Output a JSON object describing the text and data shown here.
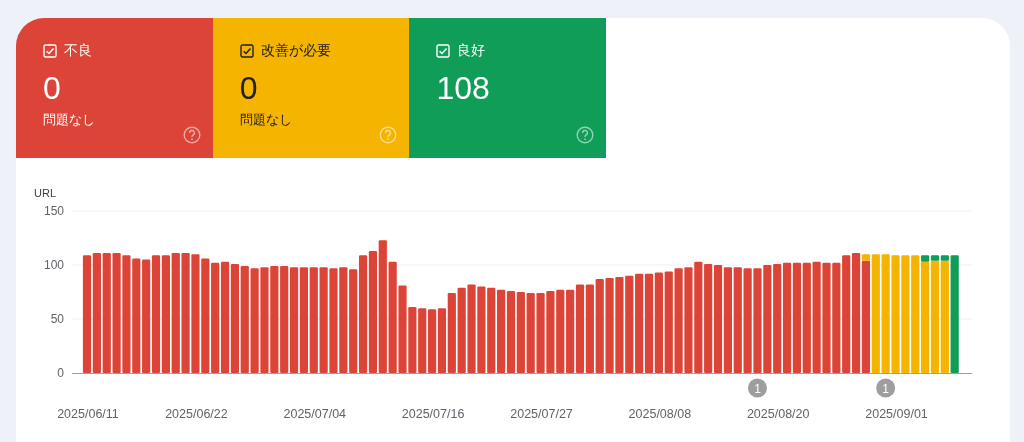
{
  "cards": [
    {
      "kind": "poor",
      "label": "不良",
      "checked": true,
      "count": "0",
      "note": "問題なし"
    },
    {
      "kind": "needs_improvement",
      "label": "改善が必要",
      "checked": true,
      "count": "0",
      "note": "問題なし"
    },
    {
      "kind": "good",
      "label": "良好",
      "checked": true,
      "count": "108"
    }
  ],
  "chart": {
    "chart_data": {
      "type": "bar",
      "stacked": true,
      "ylabel": "URL",
      "categories": [
        "2025/06/11",
        null,
        null,
        null,
        null,
        null,
        null,
        null,
        null,
        null,
        null,
        "2025/06/22",
        null,
        null,
        null,
        null,
        null,
        null,
        null,
        null,
        null,
        null,
        null,
        "2025/07/04",
        null,
        null,
        null,
        null,
        null,
        null,
        null,
        null,
        null,
        null,
        null,
        "2025/07/16",
        null,
        null,
        null,
        null,
        null,
        null,
        null,
        null,
        null,
        null,
        "2025/07/27",
        null,
        null,
        null,
        null,
        null,
        null,
        null,
        null,
        null,
        null,
        null,
        "2025/08/08",
        null,
        null,
        null,
        null,
        null,
        null,
        null,
        null,
        null,
        null,
        null,
        "2025/08/20",
        null,
        null,
        null,
        null,
        null,
        null,
        null,
        null,
        null,
        null,
        null,
        "2025/09/01",
        null,
        null,
        null,
        null,
        null,
        null
      ],
      "ylim": [
        0,
        150
      ],
      "yticks": [
        0,
        50,
        100,
        150
      ],
      "series": [
        {
          "color": "#db4437",
          "values": [
            109,
            111,
            111,
            111,
            109,
            106,
            105,
            109,
            109,
            111,
            111,
            110,
            106,
            102,
            103,
            101,
            99,
            97,
            98,
            99,
            99,
            98,
            98,
            98,
            98,
            97,
            98,
            96,
            109,
            113,
            123,
            103,
            81,
            61,
            60,
            59,
            60,
            74,
            79,
            82,
            80,
            79,
            77,
            76,
            75,
            74,
            74,
            76,
            77,
            77,
            82,
            82,
            87,
            88,
            89,
            90,
            92,
            92,
            93,
            94,
            97,
            98,
            103,
            101,
            100,
            98,
            98,
            97,
            97,
            100,
            101,
            102,
            102,
            102,
            103,
            102,
            102,
            109,
            111,
            104,
            0,
            0,
            0,
            0,
            0,
            0,
            0,
            0,
            0
          ]
        },
        {
          "color": "#f4b400",
          "values": [
            0,
            0,
            0,
            0,
            0,
            0,
            0,
            0,
            0,
            0,
            0,
            0,
            0,
            0,
            0,
            0,
            0,
            0,
            0,
            0,
            0,
            0,
            0,
            0,
            0,
            0,
            0,
            0,
            0,
            0,
            0,
            0,
            0,
            0,
            0,
            0,
            0,
            0,
            0,
            0,
            0,
            0,
            0,
            0,
            0,
            0,
            0,
            0,
            0,
            0,
            0,
            0,
            0,
            0,
            0,
            0,
            0,
            0,
            0,
            0,
            0,
            0,
            0,
            0,
            0,
            0,
            0,
            0,
            0,
            0,
            0,
            0,
            0,
            0,
            0,
            0,
            0,
            0,
            0,
            6,
            110,
            110,
            109,
            109,
            109,
            103,
            104,
            104,
            0
          ]
        },
        {
          "color": "#0f9d58",
          "values": [
            0,
            0,
            0,
            0,
            0,
            0,
            0,
            0,
            0,
            0,
            0,
            0,
            0,
            0,
            0,
            0,
            0,
            0,
            0,
            0,
            0,
            0,
            0,
            0,
            0,
            0,
            0,
            0,
            0,
            0,
            0,
            0,
            0,
            0,
            0,
            0,
            0,
            0,
            0,
            0,
            0,
            0,
            0,
            0,
            0,
            0,
            0,
            0,
            0,
            0,
            0,
            0,
            0,
            0,
            0,
            0,
            0,
            0,
            0,
            0,
            0,
            0,
            0,
            0,
            0,
            0,
            0,
            0,
            0,
            0,
            0,
            0,
            0,
            0,
            0,
            0,
            0,
            0,
            0,
            0,
            0,
            0,
            0,
            0,
            0,
            6,
            5,
            5,
            109
          ]
        }
      ],
      "annotations": [
        "1",
        "1"
      ]
    }
  }
}
